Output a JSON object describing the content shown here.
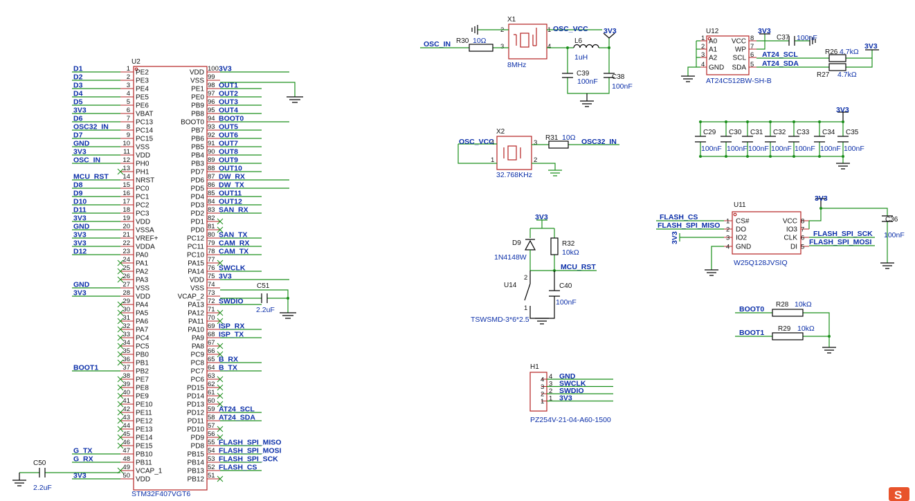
{
  "mcu": {
    "ref": "U2",
    "part": "STM32F407VGT6",
    "left": [
      {
        "n": "1",
        "p": "PE2",
        "net": "D1"
      },
      {
        "n": "2",
        "p": "PE3",
        "net": "D2"
      },
      {
        "n": "3",
        "p": "PE4",
        "net": "D3"
      },
      {
        "n": "4",
        "p": "PE5",
        "net": "D4"
      },
      {
        "n": "5",
        "p": "PE6",
        "net": "D5"
      },
      {
        "n": "6",
        "p": "VBAT",
        "net": "3V3"
      },
      {
        "n": "7",
        "p": "PC13",
        "net": "D6"
      },
      {
        "n": "8",
        "p": "PC14",
        "net": "OSC32_IN"
      },
      {
        "n": "9",
        "p": "PC15",
        "net": "D7"
      },
      {
        "n": "10",
        "p": "VSS",
        "net": "GND"
      },
      {
        "n": "11",
        "p": "VDD",
        "net": "3V3"
      },
      {
        "n": "12",
        "p": "PH0",
        "net": "OSC_IN"
      },
      {
        "n": "13",
        "p": "PH1",
        "net": ""
      },
      {
        "n": "14",
        "p": "NRST",
        "net": "MCU_RST"
      },
      {
        "n": "15",
        "p": "PC0",
        "net": "D8"
      },
      {
        "n": "16",
        "p": "PC1",
        "net": "D9"
      },
      {
        "n": "17",
        "p": "PC2",
        "net": "D10"
      },
      {
        "n": "18",
        "p": "PC3",
        "net": "D11"
      },
      {
        "n": "19",
        "p": "VDD",
        "net": "3V3"
      },
      {
        "n": "20",
        "p": "VSSA",
        "net": "GND"
      },
      {
        "n": "21",
        "p": "VREF+",
        "net": "3V3"
      },
      {
        "n": "22",
        "p": "VDDA",
        "net": "3V3"
      },
      {
        "n": "23",
        "p": "PA0",
        "net": "D12"
      },
      {
        "n": "24",
        "p": "PA1",
        "net": ""
      },
      {
        "n": "25",
        "p": "PA2",
        "net": ""
      },
      {
        "n": "26",
        "p": "PA3",
        "net": ""
      },
      {
        "n": "27",
        "p": "VSS",
        "net": "GND"
      },
      {
        "n": "28",
        "p": "VDD",
        "net": "3V3"
      },
      {
        "n": "29",
        "p": "PA4",
        "net": ""
      },
      {
        "n": "30",
        "p": "PA5",
        "net": ""
      },
      {
        "n": "31",
        "p": "PA6",
        "net": ""
      },
      {
        "n": "32",
        "p": "PA7",
        "net": ""
      },
      {
        "n": "33",
        "p": "PC4",
        "net": ""
      },
      {
        "n": "34",
        "p": "PC5",
        "net": ""
      },
      {
        "n": "35",
        "p": "PB0",
        "net": ""
      },
      {
        "n": "36",
        "p": "PB1",
        "net": ""
      },
      {
        "n": "37",
        "p": "PB2",
        "net": "BOOT1"
      },
      {
        "n": "38",
        "p": "PE7",
        "net": ""
      },
      {
        "n": "39",
        "p": "PE8",
        "net": ""
      },
      {
        "n": "40",
        "p": "PE9",
        "net": ""
      },
      {
        "n": "41",
        "p": "PE10",
        "net": ""
      },
      {
        "n": "42",
        "p": "PE11",
        "net": ""
      },
      {
        "n": "43",
        "p": "PE12",
        "net": ""
      },
      {
        "n": "44",
        "p": "PE13",
        "net": ""
      },
      {
        "n": "45",
        "p": "PE14",
        "net": ""
      },
      {
        "n": "46",
        "p": "PE15",
        "net": ""
      },
      {
        "n": "47",
        "p": "PB10",
        "net": "G_TX"
      },
      {
        "n": "48",
        "p": "PB11",
        "net": "G_RX"
      },
      {
        "n": "49",
        "p": "VCAP_1",
        "net": ""
      },
      {
        "n": "50",
        "p": "VDD",
        "net": "3V3"
      }
    ],
    "right": [
      {
        "n": "100",
        "p": "VDD",
        "net": "3V3"
      },
      {
        "n": "99",
        "p": "VSS",
        "net": ""
      },
      {
        "n": "98",
        "p": "PE1",
        "net": "OUT1"
      },
      {
        "n": "97",
        "p": "PE0",
        "net": "OUT2"
      },
      {
        "n": "96",
        "p": "PB9",
        "net": "OUT3"
      },
      {
        "n": "95",
        "p": "PB8",
        "net": "OUT4"
      },
      {
        "n": "94",
        "p": "BOOT0",
        "net": "BOOT0"
      },
      {
        "n": "93",
        "p": "PB7",
        "net": "OUT5"
      },
      {
        "n": "92",
        "p": "PB6",
        "net": "OUT6"
      },
      {
        "n": "91",
        "p": "PB5",
        "net": "OUT7"
      },
      {
        "n": "90",
        "p": "PB4",
        "net": "OUT8"
      },
      {
        "n": "89",
        "p": "PB3",
        "net": "OUT9"
      },
      {
        "n": "88",
        "p": "PD7",
        "net": "OUT10"
      },
      {
        "n": "87",
        "p": "PD6",
        "net": "DW_RX"
      },
      {
        "n": "86",
        "p": "PD5",
        "net": "DW_TX"
      },
      {
        "n": "85",
        "p": "PD4",
        "net": "OUT11"
      },
      {
        "n": "84",
        "p": "PD3",
        "net": "OUT12"
      },
      {
        "n": "83",
        "p": "PD2",
        "net": "SAN_RX"
      },
      {
        "n": "82",
        "p": "PD1",
        "net": ""
      },
      {
        "n": "81",
        "p": "PD0",
        "net": ""
      },
      {
        "n": "80",
        "p": "PC12",
        "net": "SAN_TX"
      },
      {
        "n": "79",
        "p": "PC11",
        "net": "CAM_RX"
      },
      {
        "n": "78",
        "p": "PC10",
        "net": "CAM_TX"
      },
      {
        "n": "77",
        "p": "PA15",
        "net": ""
      },
      {
        "n": "76",
        "p": "PA14",
        "net": "SWCLK"
      },
      {
        "n": "75",
        "p": "VDD",
        "net": "3V3"
      },
      {
        "n": "74",
        "p": "VSS",
        "net": ""
      },
      {
        "n": "73",
        "p": "VCAP_2",
        "net": ""
      },
      {
        "n": "72",
        "p": "PA13",
        "net": "SWDIO"
      },
      {
        "n": "71",
        "p": "PA12",
        "net": ""
      },
      {
        "n": "70",
        "p": "PA11",
        "net": ""
      },
      {
        "n": "69",
        "p": "PA10",
        "net": "ISP_RX"
      },
      {
        "n": "68",
        "p": "PA9",
        "net": "ISP_TX"
      },
      {
        "n": "67",
        "p": "PA8",
        "net": ""
      },
      {
        "n": "66",
        "p": "PC9",
        "net": ""
      },
      {
        "n": "65",
        "p": "PC8",
        "net": "B_RX"
      },
      {
        "n": "64",
        "p": "PC7",
        "net": "B_TX"
      },
      {
        "n": "63",
        "p": "PC6",
        "net": ""
      },
      {
        "n": "62",
        "p": "PD15",
        "net": ""
      },
      {
        "n": "61",
        "p": "PD14",
        "net": ""
      },
      {
        "n": "60",
        "p": "PD13",
        "net": ""
      },
      {
        "n": "59",
        "p": "PD12",
        "net": "AT24_SCL"
      },
      {
        "n": "58",
        "p": "PD11",
        "net": "AT24_SDA"
      },
      {
        "n": "57",
        "p": "PD10",
        "net": ""
      },
      {
        "n": "56",
        "p": "PD9",
        "net": ""
      },
      {
        "n": "55",
        "p": "PD8",
        "net": "FLASH_SPI_MISO"
      },
      {
        "n": "54",
        "p": "PB15",
        "net": "FLASH_SPI_MOSI"
      },
      {
        "n": "53",
        "p": "PB14",
        "net": "FLASH_SPI_SCK"
      },
      {
        "n": "52",
        "p": "PB13",
        "net": "FLASH_CS"
      },
      {
        "n": "51",
        "p": "PB12",
        "net": ""
      }
    ],
    "c51": {
      "ref": "C51",
      "val": "2.2uF"
    },
    "c50": {
      "ref": "C50",
      "val": "2.2uF"
    }
  },
  "x1": {
    "ref": "X1",
    "val": "8MHz",
    "net_in": "OSC_IN",
    "net_out": "OSC_VCC",
    "pwr": "3V3",
    "r30": {
      "ref": "R30",
      "val": "10Ω"
    },
    "l6": {
      "ref": "L6",
      "val": "1uH"
    },
    "c39": {
      "ref": "C39",
      "val": "100nF"
    },
    "c38": {
      "ref": "C38",
      "val": "100nF"
    },
    "pins": [
      "1",
      "2",
      "3",
      "4"
    ]
  },
  "x2": {
    "ref": "X2",
    "val": "32.768KHz",
    "net_vcc": "OSC_VCC",
    "net_out": "OSC32_IN",
    "r31": {
      "ref": "R31",
      "val": "10Ω"
    },
    "pins": [
      "1",
      "2",
      "3",
      "4"
    ]
  },
  "reset": {
    "pwr": "3V3",
    "d9": {
      "ref": "D9",
      "val": "1N4148W"
    },
    "r32": {
      "ref": "R32",
      "val": "10kΩ"
    },
    "net": "MCU_RST",
    "c40": {
      "ref": "C40",
      "val": "100nF"
    },
    "u14": {
      "ref": "U14",
      "val": "TSWSMD-3*6*2.5"
    },
    "pins": [
      "1",
      "2"
    ]
  },
  "hdr": {
    "ref": "H1",
    "part": "PZ254V-21-04-A60-1500",
    "pins": [
      {
        "n": "4",
        "net": "GND"
      },
      {
        "n": "3",
        "net": "SWCLK"
      },
      {
        "n": "2",
        "net": "SWDIO"
      },
      {
        "n": "1",
        "net": "3V3"
      }
    ]
  },
  "eeprom": {
    "ref": "U12",
    "part": "AT24C512BW-SH-B",
    "pwr": "3V3",
    "left": [
      {
        "n": "1",
        "p": "A0"
      },
      {
        "n": "2",
        "p": "A1"
      },
      {
        "n": "3",
        "p": "A2"
      },
      {
        "n": "4",
        "p": "GND"
      }
    ],
    "right": [
      {
        "n": "8",
        "p": "VCC"
      },
      {
        "n": "7",
        "p": "WP"
      },
      {
        "n": "6",
        "p": "SCL",
        "net": "AT24_SCL"
      },
      {
        "n": "5",
        "p": "SDA",
        "net": "AT24_SDA"
      }
    ],
    "c37": {
      "ref": "C37",
      "val": "100nF"
    },
    "r26": {
      "ref": "R26",
      "val": "4.7kΩ"
    },
    "r27": {
      "ref": "R27",
      "val": "4.7kΩ"
    },
    "pwr2": "3V3"
  },
  "decoup": {
    "pwr": "3V3",
    "caps": [
      {
        "ref": "C29",
        "val": "100nF"
      },
      {
        "ref": "C30",
        "val": "100nF"
      },
      {
        "ref": "C31",
        "val": "100nF"
      },
      {
        "ref": "C32",
        "val": "100nF"
      },
      {
        "ref": "C33",
        "val": "100nF"
      },
      {
        "ref": "C34",
        "val": "100nF"
      },
      {
        "ref": "C35",
        "val": "100nF"
      }
    ]
  },
  "flash": {
    "ref": "U11",
    "part": "W25Q128JVSIQ",
    "pwr": "3V3",
    "pwr_io2": "3V3",
    "left": [
      {
        "n": "1",
        "p": "CS#",
        "net": "FLASH_CS"
      },
      {
        "n": "2",
        "p": "DO",
        "net": "FLASH_SPI_MISO"
      },
      {
        "n": "3",
        "p": "IO2"
      },
      {
        "n": "4",
        "p": "GND"
      }
    ],
    "right": [
      {
        "n": "8",
        "p": "VCC"
      },
      {
        "n": "7",
        "p": "IO3"
      },
      {
        "n": "6",
        "p": "CLK",
        "net": "FLASH_SPI_SCK"
      },
      {
        "n": "5",
        "p": "DI",
        "net": "FLASH_SPI_MOSI"
      }
    ],
    "c36": {
      "ref": "C36",
      "val": "100nF"
    }
  },
  "boot": {
    "boot0": {
      "net": "BOOT0",
      "ref": "R28",
      "val": "10kΩ"
    },
    "boot1": {
      "net": "BOOT1",
      "ref": "R29",
      "val": "10kΩ"
    }
  },
  "logo": {
    "glyph": "S"
  }
}
